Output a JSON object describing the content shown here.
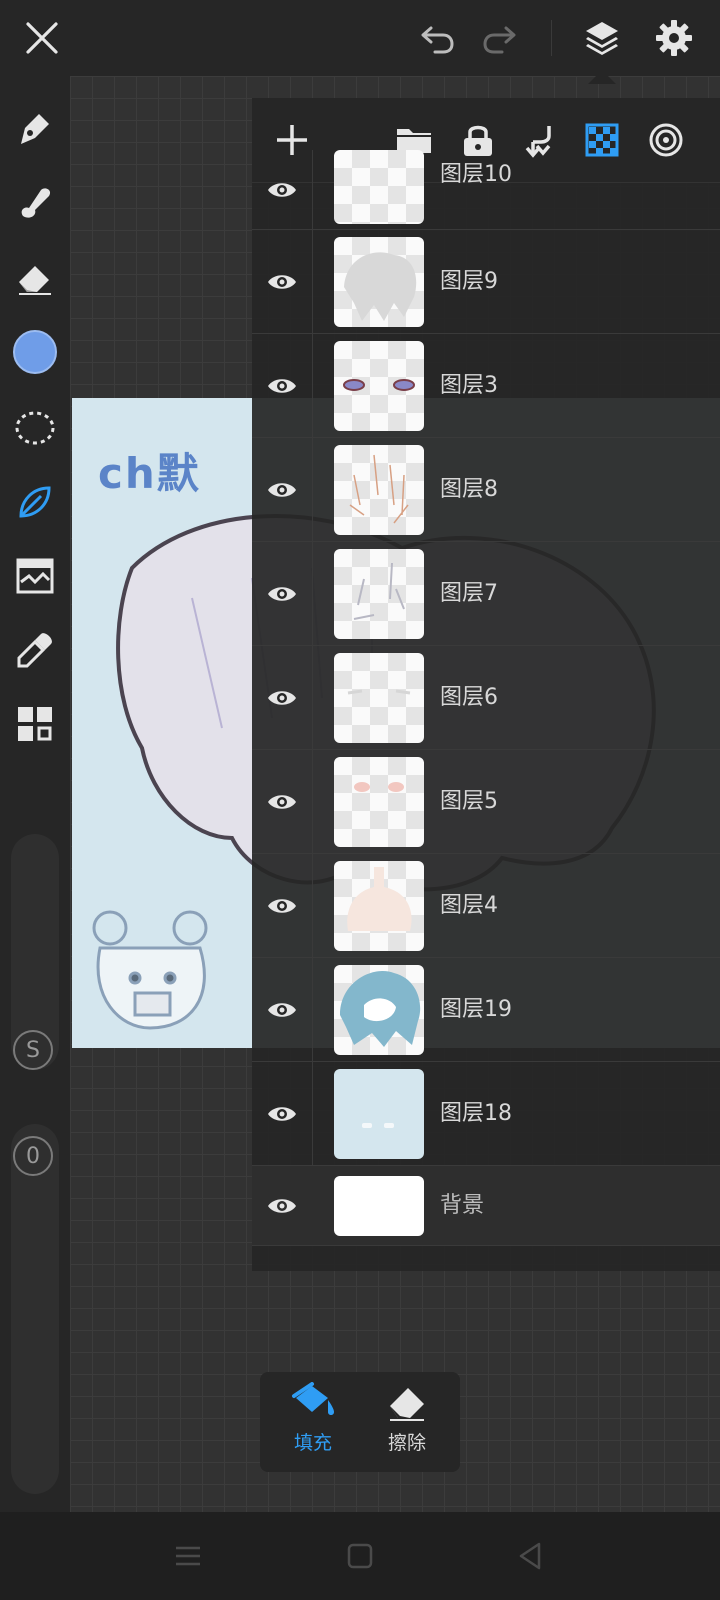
{
  "top_bar": {
    "icons": [
      "close-icon",
      "undo-icon",
      "redo-icon",
      "layers-icon",
      "settings-icon"
    ]
  },
  "left_toolbar": {
    "tools": [
      "pen-icon",
      "smudge-icon",
      "eraser-icon",
      "color-swatch",
      "lasso-select-icon",
      "leaf-brush-icon",
      "adjust-icon",
      "eyedropper-icon",
      "grid-icon"
    ],
    "current_color": "#6f9de8",
    "size_slider_label": "S",
    "opacity_slider_label": "0"
  },
  "canvas": {
    "artwork_text": "ch默"
  },
  "layers_panel": {
    "toolbar_icons": [
      "add-layer-icon",
      "folder-icon",
      "lock-icon",
      "merge-down-icon",
      "transparency-icon",
      "target-icon"
    ],
    "layers": [
      {
        "name": "图层10"
      },
      {
        "name": "图层9"
      },
      {
        "name": "图层3"
      },
      {
        "name": "图层8"
      },
      {
        "name": "图层7"
      },
      {
        "name": "图层6"
      },
      {
        "name": "图层5"
      },
      {
        "name": "图层4"
      },
      {
        "name": "图层19"
      },
      {
        "name": "图层18"
      },
      {
        "name": "背景"
      }
    ]
  },
  "fill_popup": {
    "fill_label": "填充",
    "erase_label": "擦除",
    "active_color": "#2f9df4"
  },
  "nav_bar": {
    "icons": [
      "menu-icon",
      "home-icon",
      "back-icon"
    ]
  }
}
